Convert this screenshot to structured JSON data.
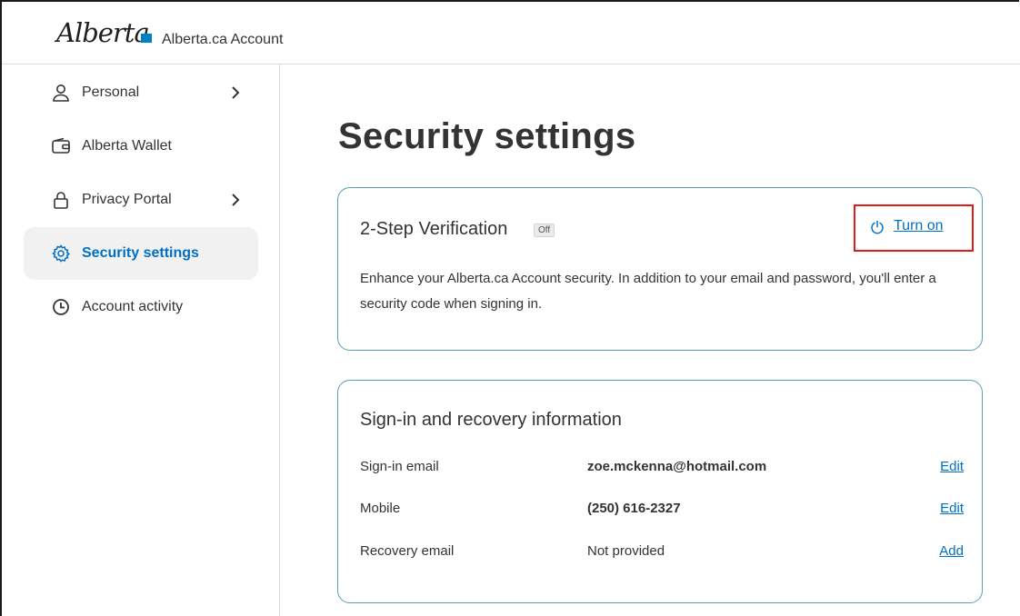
{
  "header": {
    "logo_text": "Alberta",
    "app_title": "Alberta.ca Account"
  },
  "sidebar": {
    "items": [
      {
        "label": "Personal",
        "icon": "person-icon",
        "has_chevron": true,
        "active": false
      },
      {
        "label": "Alberta Wallet",
        "icon": "wallet-icon",
        "has_chevron": false,
        "active": false
      },
      {
        "label": "Privacy Portal",
        "icon": "lock-icon",
        "has_chevron": true,
        "active": false
      },
      {
        "label": "Security settings",
        "icon": "gear-icon",
        "has_chevron": false,
        "active": true
      },
      {
        "label": "Account activity",
        "icon": "clock-icon",
        "has_chevron": false,
        "active": false
      }
    ]
  },
  "main": {
    "title": "Security settings",
    "two_step": {
      "title": "2-Step Verification",
      "status_badge": "Off",
      "action_label": "Turn on",
      "description": "Enhance your Alberta.ca Account security. In addition to your email and password, you'll enter a security code when signing in."
    },
    "signin": {
      "title": "Sign-in and recovery information",
      "rows": [
        {
          "label": "Sign-in email",
          "value": "zoe.mckenna@hotmail.com",
          "action": "Edit"
        },
        {
          "label": "Mobile",
          "value": "(250) 616-2327",
          "action": "Edit"
        },
        {
          "label": "Recovery email",
          "value": "Not provided",
          "action": "Add"
        }
      ]
    }
  },
  "colors": {
    "accent": "#0070c4",
    "card_border": "#5b9fb3",
    "highlight_border": "#e01b1b"
  }
}
